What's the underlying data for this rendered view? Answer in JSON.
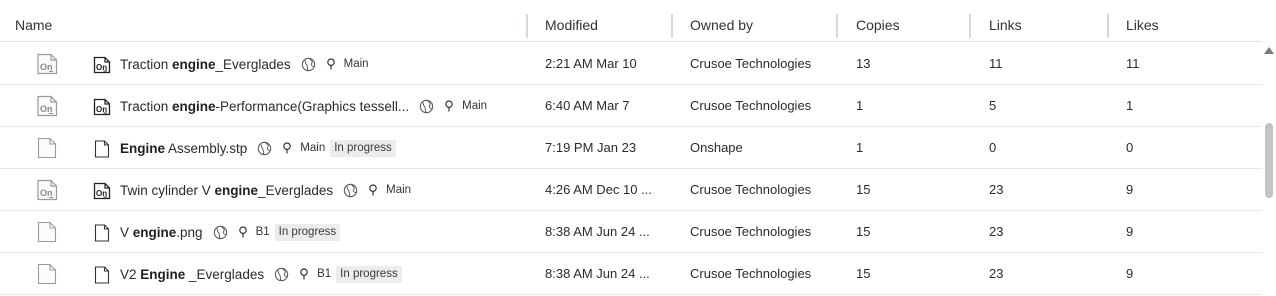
{
  "columns": {
    "name": "Name",
    "modified": "Modified",
    "owned_by": "Owned by",
    "copies": "Copies",
    "links": "Links",
    "likes": "Likes"
  },
  "rows": [
    {
      "type": "onshape",
      "name_pre": "Traction ",
      "name_bold": "engine",
      "name_post": "_Everglades",
      "branch": "Main",
      "badge": "",
      "modified": "2:21 AM Mar 10",
      "owner": "Crusoe Technologies",
      "copies": "13",
      "links": "11",
      "likes": "11"
    },
    {
      "type": "onshape",
      "name_pre": "Traction ",
      "name_bold": "engine",
      "name_post": "-Performance(Graphics tessell...",
      "branch": "Main",
      "badge": "",
      "modified": "6:40 AM Mar 7",
      "owner": "Crusoe Technologies",
      "copies": "1",
      "links": "5",
      "likes": "1"
    },
    {
      "type": "file",
      "name_pre": "",
      "name_bold": "Engine",
      "name_post": " Assembly.stp",
      "branch": "Main",
      "badge": "In progress",
      "modified": "7:19 PM Jan 23",
      "owner": "Onshape",
      "copies": "1",
      "links": "0",
      "likes": "0"
    },
    {
      "type": "onshape",
      "name_pre": "Twin cylinder V ",
      "name_bold": "engine",
      "name_post": "_Everglades",
      "branch": "Main",
      "badge": "",
      "modified": "4:26 AM Dec 10 ...",
      "owner": "Crusoe Technologies",
      "copies": "15",
      "links": "23",
      "likes": "9"
    },
    {
      "type": "file",
      "name_pre": "V ",
      "name_bold": "engine",
      "name_post": ".png",
      "branch": "B1",
      "badge": "In progress",
      "modified": "8:38 AM Jun 24 ...",
      "owner": "Crusoe Technologies",
      "copies": "15",
      "links": "23",
      "likes": "9"
    },
    {
      "type": "file",
      "name_pre": "V2 ",
      "name_bold": "Engine",
      "name_post": " _Everglades",
      "branch": "B1",
      "badge": "In progress",
      "modified": "8:38 AM Jun 24 ...",
      "owner": "Crusoe Technologies",
      "copies": "15",
      "links": "23",
      "likes": "9"
    }
  ],
  "icons": {
    "onshape": "onshape-document-icon",
    "file": "file-icon",
    "public": "globe-icon",
    "branch": "branch-pin-icon"
  },
  "colors": {
    "border": "#e1e3e6",
    "badge_bg": "#ececee",
    "scroll_thumb": "#c4c4c4"
  }
}
